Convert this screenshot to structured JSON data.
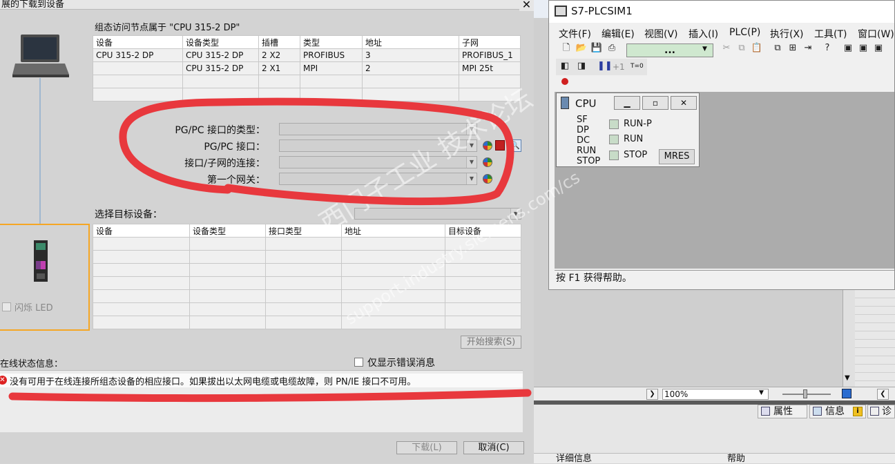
{
  "dialog": {
    "title": "展的下载到设备",
    "close": "✕",
    "config_caption": "组态访问节点属于 \"CPU 315-2 DP\"",
    "config_table": {
      "headers": [
        "设备",
        "设备类型",
        "插槽",
        "类型",
        "地址",
        "子网"
      ],
      "rows": [
        [
          "CPU 315-2 DP",
          "CPU 315-2 DP",
          "2 X2",
          "PROFIBUS",
          "3",
          "PROFIBUS_1"
        ],
        [
          "",
          "CPU 315-2 DP",
          "2 X1",
          "MPI",
          "2",
          "MPI 25t"
        ]
      ]
    },
    "pgpc_type_label": "PG/PC 接口的类型：",
    "pgpc_label": "PG/PC 接口：",
    "subnet_conn_label": "接口/子网的连接：",
    "gateway_label": "第一个网关：",
    "select_target_label": "选择目标设备：",
    "target_table": {
      "headers": [
        "设备",
        "设备类型",
        "接口类型",
        "地址",
        "目标设备"
      ]
    },
    "flash_led": "闪烁 LED",
    "start_search": "开始搜索(S)",
    "status_label": "在线状态信息：",
    "only_errors": "仅显示错误消息",
    "error_message": "没有可用于在线连接所组态设备的相应接口。如果拔出以太网电缆或电缆故障，则 PN/IE 接口不可用。",
    "download_button": "下载(L)",
    "cancel_button": "取消(C)"
  },
  "watermark": {
    "line1": "西门子工业 技术论坛",
    "line2": "support.industry.siemens.com/cs"
  },
  "plcsim": {
    "title": "S7-PLCSIM1",
    "menu": [
      "文件(F)",
      "编辑(E)",
      "视图(V)",
      "插入(I)",
      "PLC(P)",
      "执行(X)",
      "工具(T)",
      "窗口(W)"
    ],
    "access_combo": "...",
    "cycle_plus": "+1",
    "t0": "T=0",
    "status_bar": "按 F1 获得帮助。",
    "cpu": {
      "title": "CPU",
      "leds": [
        "SF",
        "DP",
        "DC",
        "RUN",
        "STOP"
      ],
      "modes": [
        "RUN-P",
        "RUN",
        "STOP"
      ],
      "mres": "MRES"
    }
  },
  "bottom": {
    "zoom": "100%",
    "tabs": [
      "属性",
      "信息",
      "诊"
    ],
    "detail": "详细信息",
    "help": "帮助"
  },
  "colors": {
    "annotation_red": "#e8383d",
    "highlight_orange": "#f5a623",
    "led_off": "#c8dcc8"
  }
}
